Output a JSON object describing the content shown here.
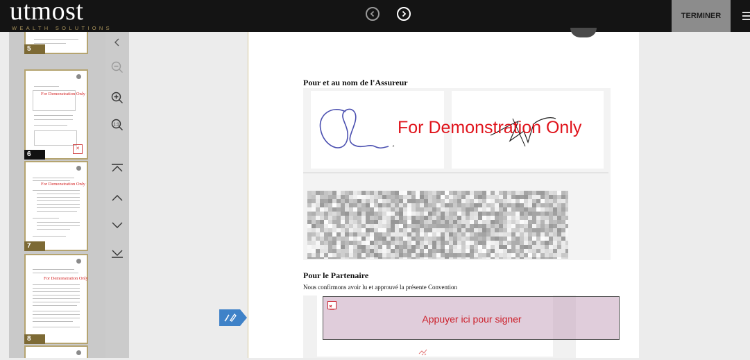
{
  "header": {
    "logo_main": "utmost",
    "logo_sub": "WEALTH SOLUTIONS",
    "finish_label": "TERMINER",
    "prev_icon": "chevron-left-circle-icon",
    "next_icon": "chevron-right-circle-icon",
    "menu_icon": "hamburger-menu-icon"
  },
  "thumbnails": [
    {
      "number": "5"
    },
    {
      "number": "6",
      "watermark": "For Demonstration Only",
      "active": true
    },
    {
      "number": "7",
      "watermark": "For Demonstration Only"
    },
    {
      "number": "8",
      "watermark": "For Demonstration Only"
    }
  ],
  "toolbar": {
    "collapse_icon": "chevron-left-icon",
    "zoom_out_icon": "zoom-out-icon",
    "zoom_in_icon": "zoom-in-icon",
    "zoom_actual_icon": "zoom-actual-size-icon",
    "first_page_icon": "first-page-icon",
    "prev_page_icon": "chevron-up-icon",
    "next_page_icon": "chevron-down-icon",
    "last_page_icon": "last-page-icon"
  },
  "document": {
    "insurer_heading": "Pour et au nom de l'Assureur",
    "watermark": "For Demonstration Only",
    "partner_heading": "Pour le Partenaire",
    "partner_text": "Nous confirmons avoir lu et approuvé la présente Convention",
    "sign_prompt": "Appuyer ici pour signer"
  },
  "colors": {
    "topbar": "#141414",
    "accent_gold": "#a8925a",
    "watermark_red": "#e0141c",
    "sign_zone": "#be96b4"
  }
}
